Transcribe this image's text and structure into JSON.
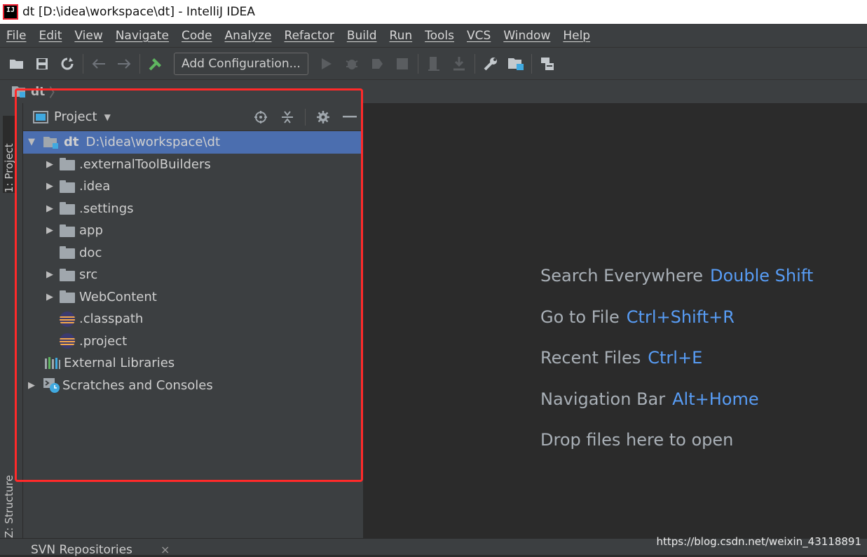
{
  "window": {
    "title": "dt [D:\\idea\\workspace\\dt] - IntelliJ IDEA",
    "logo_text": "IJ"
  },
  "menu": [
    "File",
    "Edit",
    "View",
    "Navigate",
    "Code",
    "Analyze",
    "Refactor",
    "Build",
    "Run",
    "Tools",
    "VCS",
    "Window",
    "Help"
  ],
  "toolbar": {
    "add_configuration": "Add Configuration..."
  },
  "navbar": {
    "project_name": "dt"
  },
  "left_strip": {
    "project_tab": "1: Project",
    "structure_tab": "Z: Structure"
  },
  "project_panel": {
    "title": "Project",
    "root": {
      "name": "dt",
      "path": "D:\\idea\\workspace\\dt"
    },
    "items": [
      {
        "label": ".externalToolBuilders",
        "type": "folder",
        "expandable": true
      },
      {
        "label": ".idea",
        "type": "folder",
        "expandable": true
      },
      {
        "label": ".settings",
        "type": "folder",
        "expandable": true
      },
      {
        "label": "app",
        "type": "folder",
        "expandable": true
      },
      {
        "label": "doc",
        "type": "folder",
        "expandable": false
      },
      {
        "label": "src",
        "type": "folder",
        "expandable": true
      },
      {
        "label": "WebContent",
        "type": "folder",
        "expandable": true
      },
      {
        "label": ".classpath",
        "type": "eclipse-file",
        "expandable": false
      },
      {
        "label": ".project",
        "type": "eclipse-file",
        "expandable": false
      }
    ],
    "external_libraries": "External Libraries",
    "scratches": "Scratches and Consoles"
  },
  "editor_hints": [
    {
      "text": "Search Everywhere",
      "shortcut": "Double Shift"
    },
    {
      "text": "Go to File",
      "shortcut": "Ctrl+Shift+R"
    },
    {
      "text": "Recent Files",
      "shortcut": "Ctrl+E"
    },
    {
      "text": "Navigation Bar",
      "shortcut": "Alt+Home"
    },
    {
      "text": "Drop files here to open",
      "shortcut": ""
    }
  ],
  "bottom_bar": {
    "svn_tab": "SVN Repositories",
    "close": "×"
  },
  "watermark": "https://blog.csdn.net/weixin_43118891",
  "colors": {
    "accent": "#589df6",
    "selection": "#4b6eaf",
    "highlight_box": "#ff2a2a",
    "run_green": "#5fb660"
  }
}
